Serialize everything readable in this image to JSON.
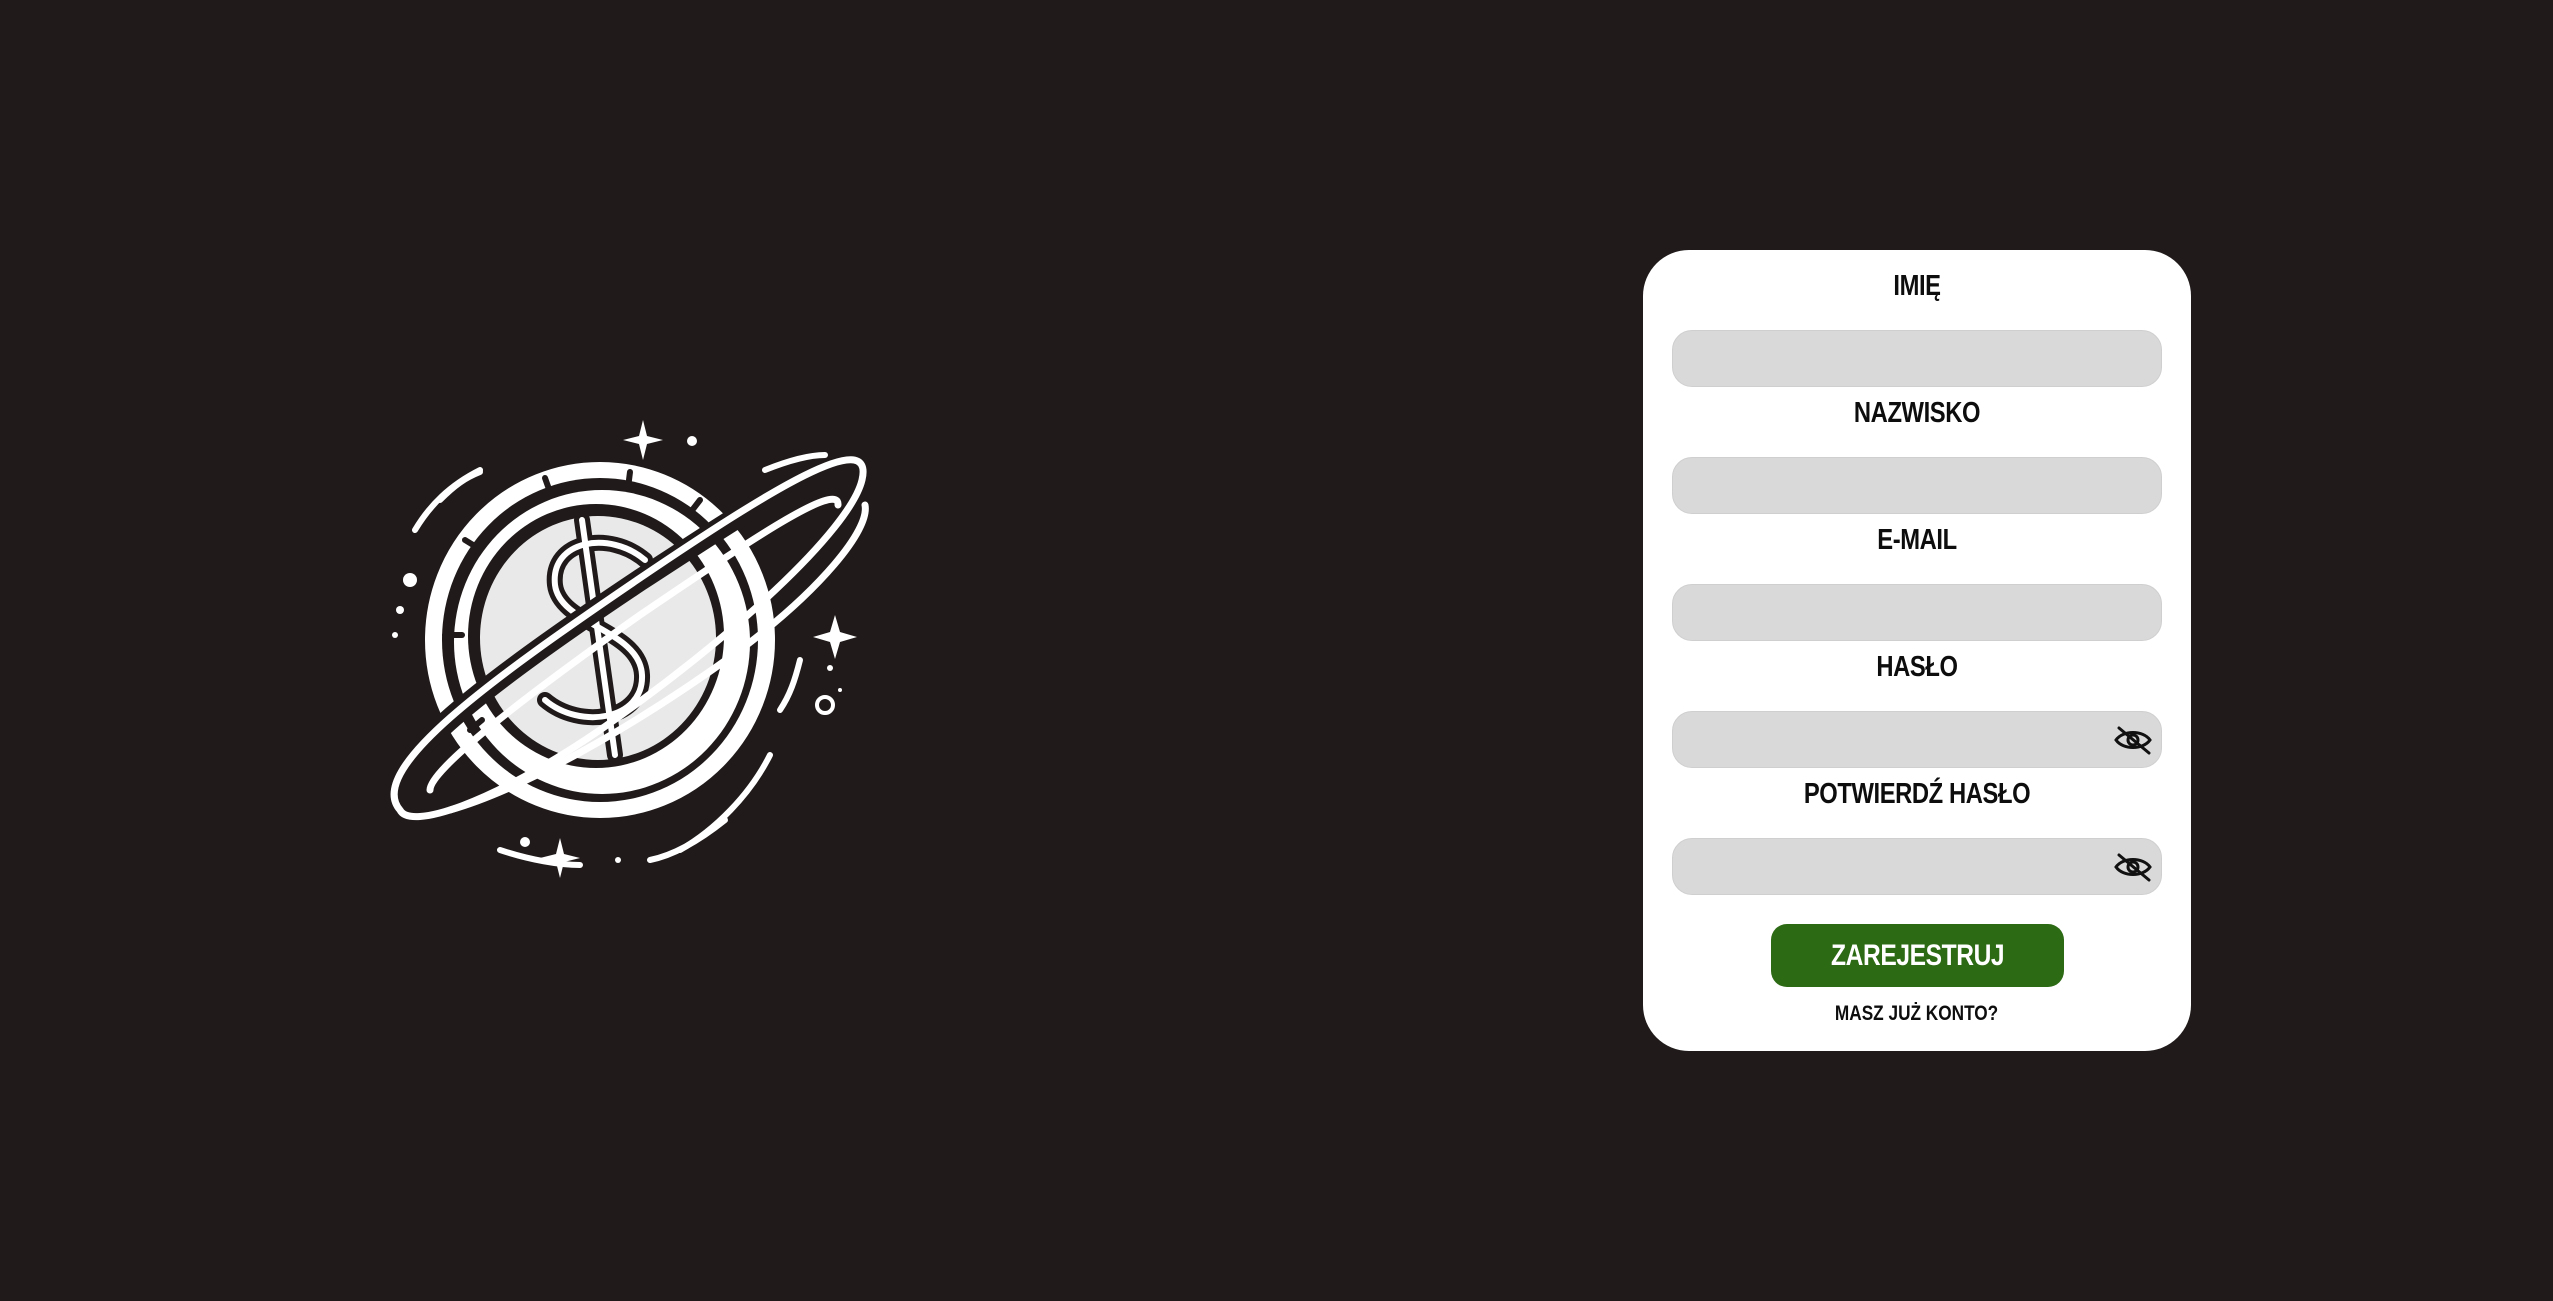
{
  "logo": {
    "icon": "dollar-coin-planet-logo",
    "stroke_color": "#ffffff",
    "fill_color": "#201a1a"
  },
  "colors": {
    "background": "#201a1a",
    "card": "#ffffff",
    "field": "#d9d9d9",
    "button": "#2d6a14",
    "text": "#0d0d0d"
  },
  "form": {
    "first_name": {
      "label": "IMIĘ",
      "value": "",
      "placeholder": ""
    },
    "last_name": {
      "label": "NAZWISKO",
      "value": "",
      "placeholder": ""
    },
    "email": {
      "label": "E-MAIL",
      "value": "",
      "placeholder": ""
    },
    "password": {
      "label": "HASŁO",
      "value": "",
      "placeholder": "",
      "toggle_icon": "eye-slash-icon"
    },
    "confirm_password": {
      "label": "POTWIERDŹ HASŁO",
      "value": "",
      "placeholder": "",
      "toggle_icon": "eye-slash-icon"
    },
    "submit_label": "ZAREJESTRUJ",
    "login_link": "MASZ JUŻ KONTO?"
  }
}
